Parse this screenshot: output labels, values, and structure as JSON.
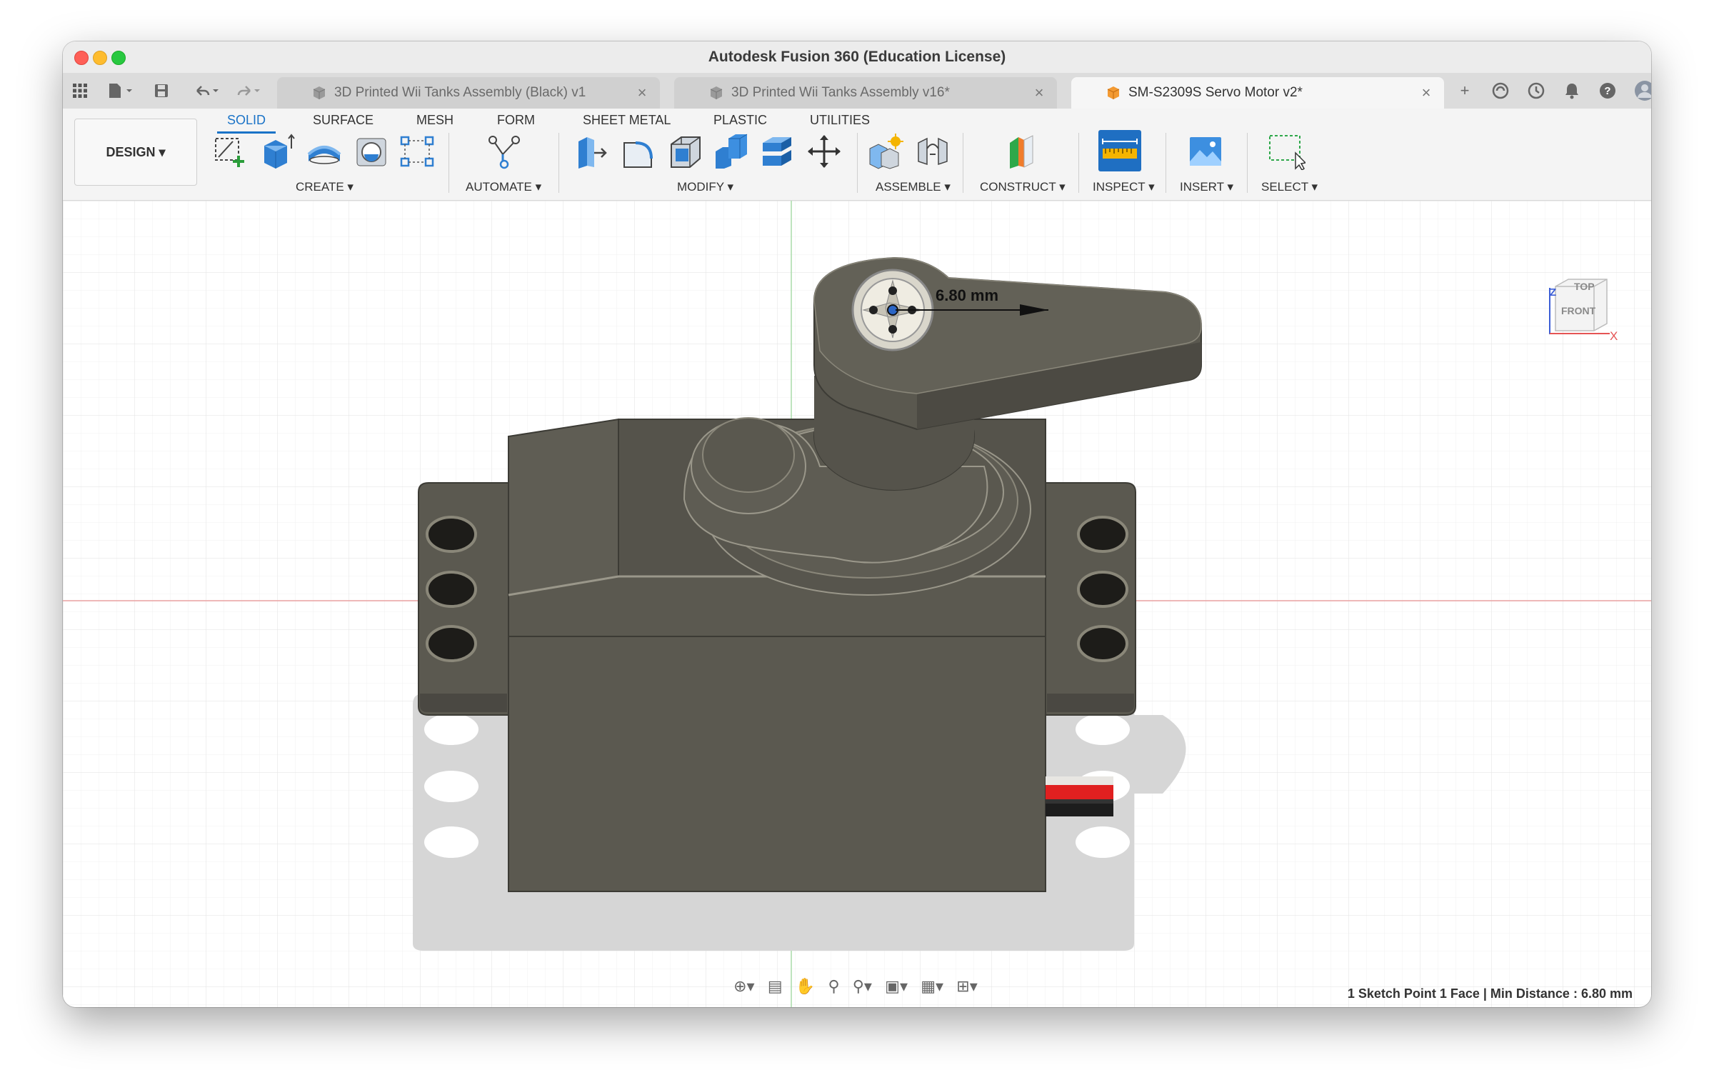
{
  "window": {
    "title": "Autodesk Fusion 360 (Education License)"
  },
  "tabs": [
    {
      "label": "3D Printed Wii Tanks Assembly (Black) v1",
      "active": false
    },
    {
      "label": "3D Printed Wii Tanks Assembly v16*",
      "active": false
    },
    {
      "label": "SM-S2309S Servo Motor v2*",
      "active": true
    }
  ],
  "toolbar": {
    "workspace": "DESIGN ▾",
    "tabs": [
      "SOLID",
      "SURFACE",
      "MESH",
      "FORM",
      "SHEET METAL",
      "PLASTIC",
      "UTILITIES"
    ],
    "active_tab": "SOLID",
    "groups": [
      "CREATE ▾",
      "AUTOMATE ▾",
      "MODIFY ▾",
      "ASSEMBLE ▾",
      "CONSTRUCT ▾",
      "INSPECT ▾",
      "INSERT ▾",
      "SELECT ▾"
    ]
  },
  "viewport": {
    "measurement_label": "6.80 mm",
    "viewcube": {
      "top": "TOP",
      "front": "FRONT",
      "axis_z": "Z",
      "axis_x": "X"
    }
  },
  "status": {
    "text": "1 Sketch Point 1 Face | Min Distance : 6.80 mm"
  },
  "colors": {
    "accent": "#1a73c7",
    "model_body": "#5b5950",
    "axis_red": "#e9a1a1",
    "axis_green": "#a8dca8"
  }
}
